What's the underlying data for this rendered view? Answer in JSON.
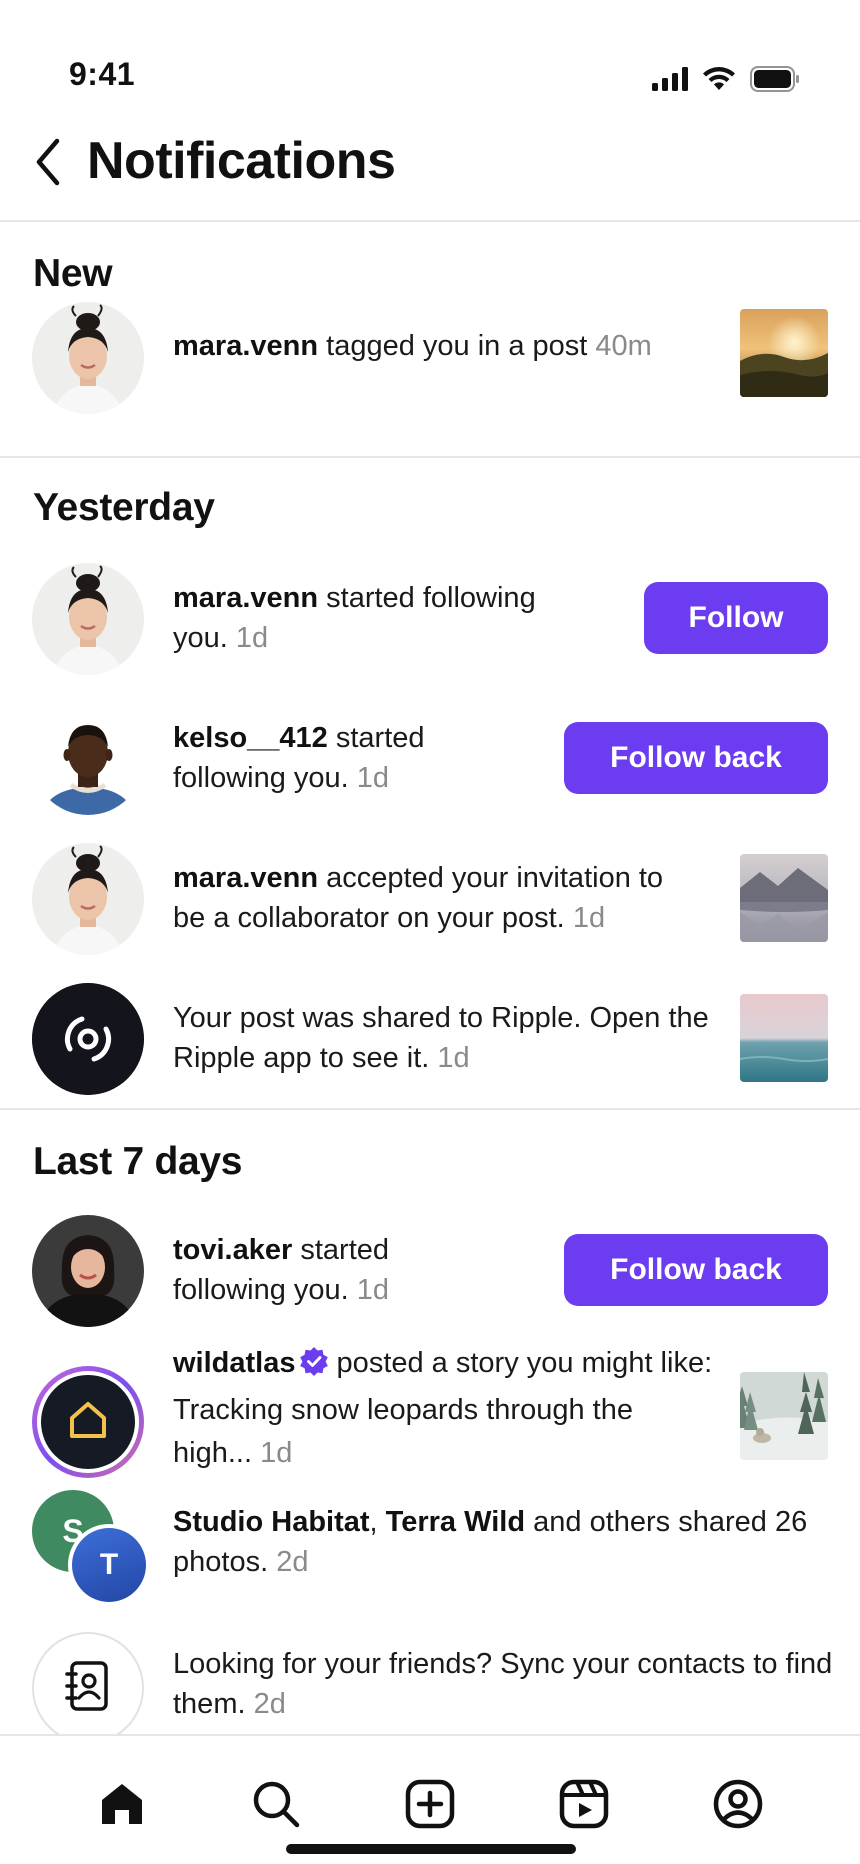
{
  "status_bar": {
    "time": "9:41"
  },
  "header": {
    "title": "Notifications"
  },
  "sections": {
    "new": "New",
    "yesterday": "Yesterday",
    "last7": "Last 7 days"
  },
  "notifications": [
    {
      "user": "mara.venn",
      "text": " tagged you in a post",
      "time": "40m"
    },
    {
      "user": "mara.venn",
      "text": " started following you.",
      "time": "1d",
      "button": "Follow"
    },
    {
      "user": "kelso__412",
      "text": " started following you.",
      "time": "1d",
      "button": "Follow back"
    },
    {
      "user": "mara.venn",
      "text": " accepted your invitation to be a collaborator on your post.",
      "time": "1d"
    },
    {
      "text": "Your post was shared to Ripple. Open the Ripple app to see it.",
      "time": "1d"
    },
    {
      "user": "tovi.aker",
      "text": " started following you.",
      "time": "1d",
      "button": "Follow back"
    },
    {
      "user": "wildatlas",
      "text": " posted a story you might like: Tracking snow leopards through the high...",
      "time": "1d"
    },
    {
      "user": "Studio Habitat",
      "sep": ", ",
      "user2": "Terra Wild",
      "text": " and others shared 26 photos.",
      "time": "2d",
      "avatar_letter_1": "S",
      "avatar_letter_2": "T"
    },
    {
      "text": "Looking for your friends? Sync your contacts to find them.",
      "time": "2d"
    }
  ],
  "colors": {
    "accent": "#6c3cf0",
    "muted": "#8a8a8a",
    "verified": "#6c3cf0"
  },
  "icons": {
    "back": "chevron-left-icon",
    "nav": [
      "home-icon",
      "search-icon",
      "create-icon",
      "reels-icon",
      "profile-icon"
    ]
  }
}
